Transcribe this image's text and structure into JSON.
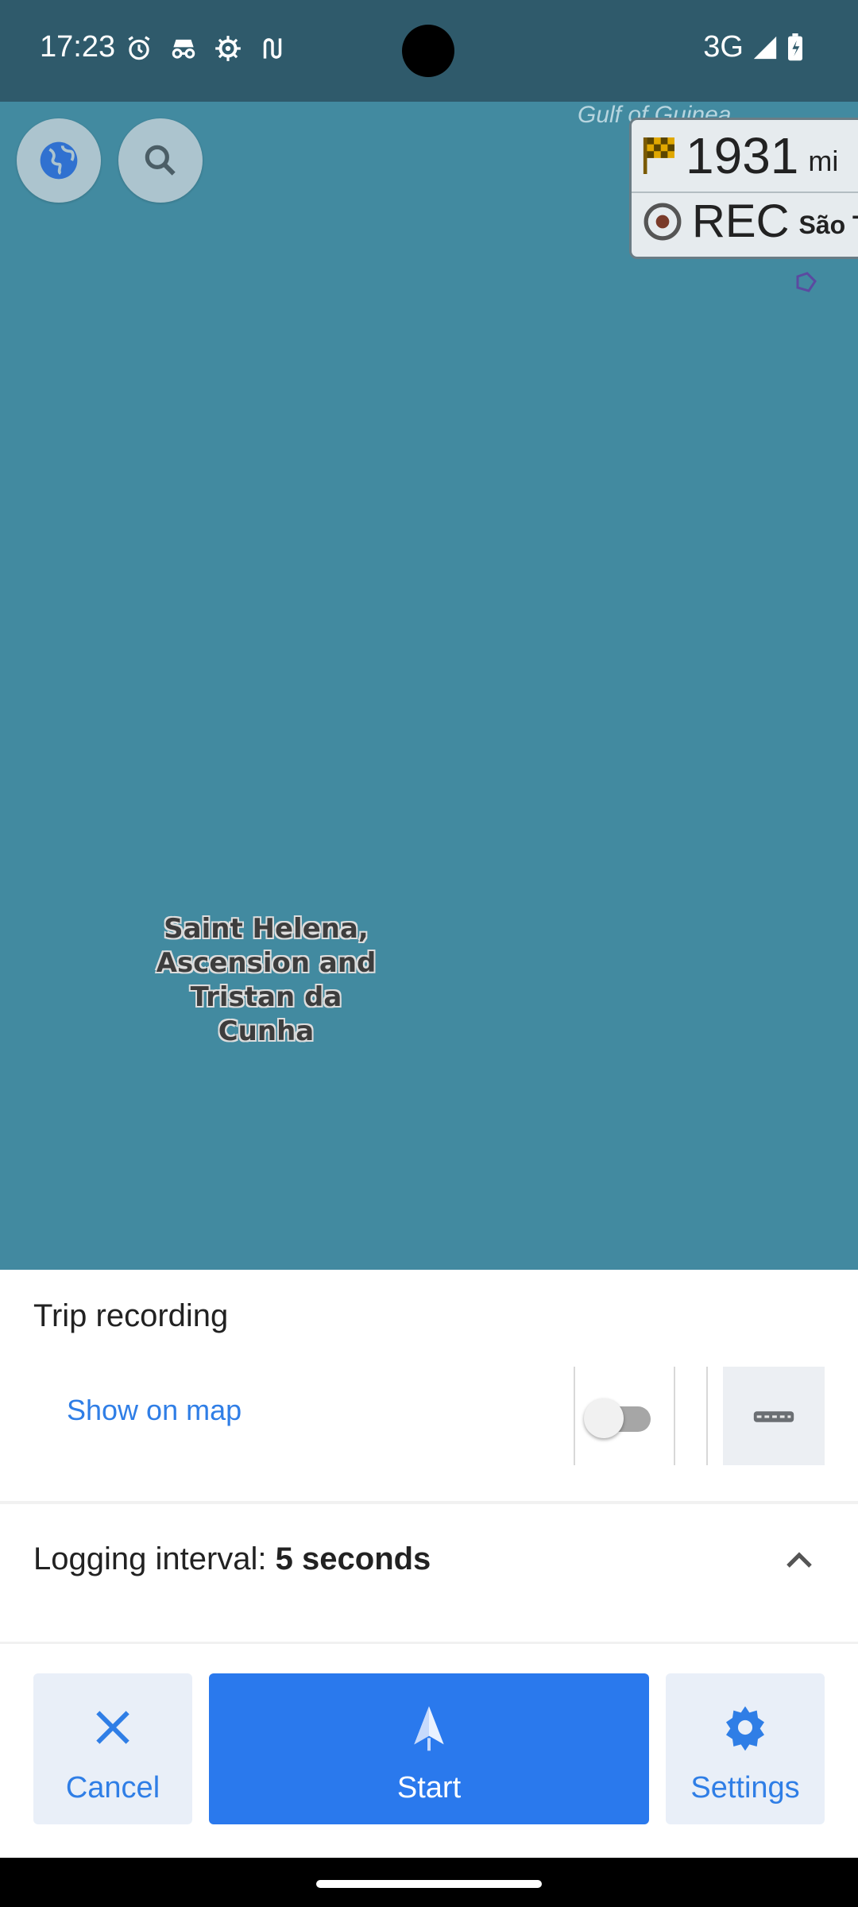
{
  "status_bar": {
    "time": "17:23",
    "icons": [
      "alarm-icon",
      "incognito-icon",
      "gear-icon",
      "route-icon"
    ],
    "network": "3G",
    "signal_icon": "signal-icon",
    "battery_icon": "battery-charging-icon"
  },
  "map": {
    "gulf_label": "Gulf of Guinea",
    "distance_value": "1931",
    "distance_unit": "mi",
    "rec_label": "REC",
    "rec_place": "São T",
    "region_label": "Saint Helena, Ascension and Tristan da Cunha",
    "buttons": [
      "globe-icon",
      "search-icon"
    ]
  },
  "sheet": {
    "title": "Trip recording",
    "show_on_map": "Show on map",
    "show_on_map_enabled": false,
    "logging_prefix": "Logging interval: ",
    "logging_value": "5 seconds",
    "cancel_label": "Cancel",
    "start_label": "Start",
    "settings_label": "Settings"
  },
  "colors": {
    "accent": "#2a79ed",
    "map_sea": "#428aa0",
    "status_bar": "#2f5a6b"
  }
}
